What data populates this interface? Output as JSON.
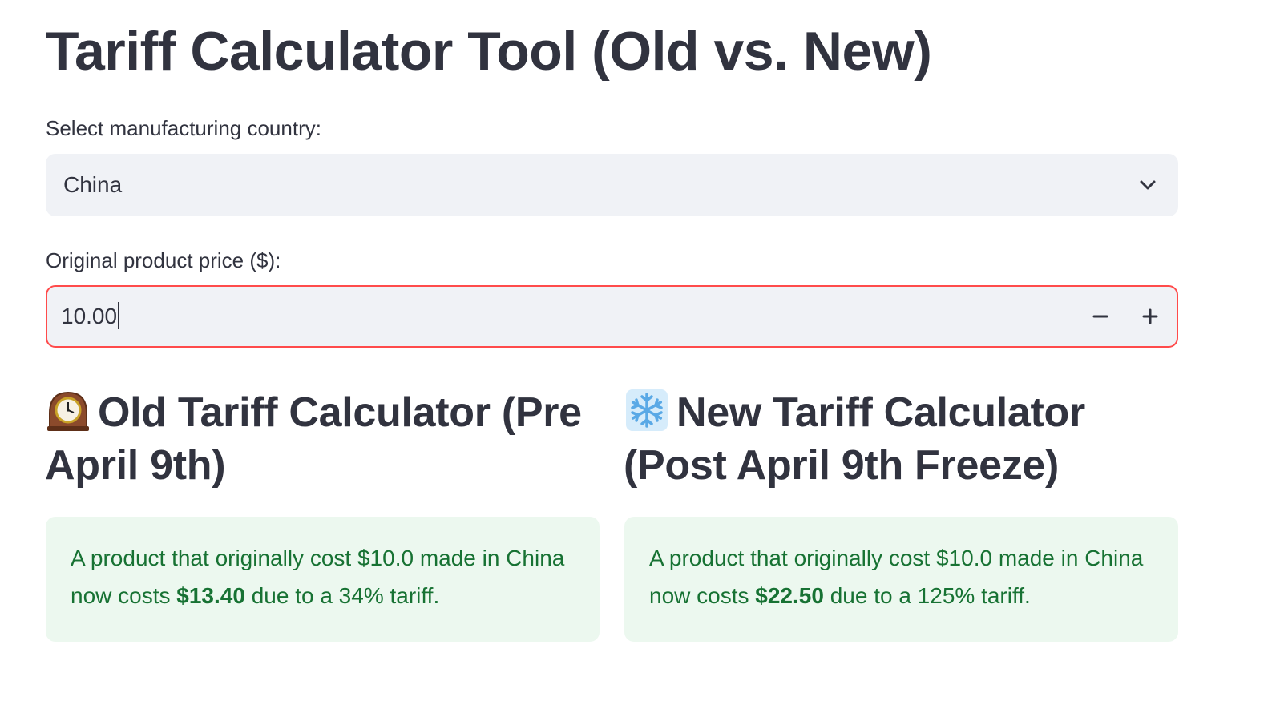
{
  "page": {
    "title": "Tariff Calculator Tool (Old vs. New)"
  },
  "country_select": {
    "label": "Select manufacturing country:",
    "selected_value": "China",
    "icon": "chevron-down-icon"
  },
  "price_input": {
    "label": "Original product price ($):",
    "value": "10.00",
    "decrement_label": "−",
    "increment_label": "+",
    "border_color": "#ff4b4b"
  },
  "old_calculator": {
    "icon": "mantelpiece-clock-icon",
    "heading": "Old Tariff Calculator (Pre April 9th)",
    "result_prefix": "A product that originally cost $10.0 made in China now costs ",
    "result_price": "$13.40",
    "result_suffix": " due to a 34% tariff."
  },
  "new_calculator": {
    "icon": "snowflake-icon",
    "heading": "New Tariff Calculator (Post April 9th Freeze)",
    "result_prefix": "A product that originally cost $10.0 made in China now costs ",
    "result_price": "$22.50",
    "result_suffix": " due to a 125% tariff."
  },
  "colors": {
    "text": "#31333f",
    "input_bg": "#f0f2f6",
    "success_bg": "#ecf8ef",
    "success_text": "#177233",
    "focus_border": "#ff4b4b"
  }
}
